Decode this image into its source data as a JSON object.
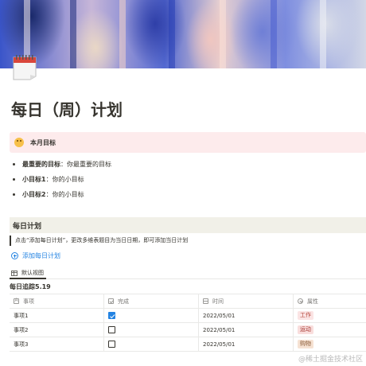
{
  "page": {
    "title": "每日（周）计划",
    "icon": "calendar-icon"
  },
  "callout": {
    "icon": "smile-emoji-icon",
    "text": "本月目标"
  },
  "goals": [
    {
      "label": "最重要的目标",
      "sep": "：",
      "text": "你最重要的目标"
    },
    {
      "label": "小目标1",
      "sep": "：",
      "text": "你的小目标"
    },
    {
      "label": "小目标2",
      "sep": "：",
      "text": "你的小目标"
    }
  ],
  "section": {
    "heading": "每日计划",
    "quote": "点击“添加每日计划”，更改多维表题目为当日日期，即可添加当日计划",
    "add_button": "添加每日计划"
  },
  "database": {
    "view_label": "默认视图",
    "title": "每日追踪5.19",
    "columns": [
      {
        "label": "事项",
        "icon": "text-property-icon"
      },
      {
        "label": "完成",
        "icon": "checkbox-property-icon"
      },
      {
        "label": "时间",
        "icon": "date-property-icon"
      },
      {
        "label": "属性",
        "icon": "select-property-icon"
      }
    ],
    "rows": [
      {
        "name": "事项1",
        "done": true,
        "date": "2022/05/01",
        "tag": "工作",
        "tag_bg": "#fbe4e4",
        "tag_fg": "#b5473b"
      },
      {
        "name": "事项2",
        "done": false,
        "date": "2022/05/01",
        "tag": "运动",
        "tag_bg": "#f9dedd",
        "tag_fg": "#a63a34"
      },
      {
        "name": "事项3",
        "done": false,
        "date": "2022/05/01",
        "tag": "购物",
        "tag_bg": "#f6e2d3",
        "tag_fg": "#8a5a35"
      }
    ]
  },
  "watermark": "@稀土掘金技术社区",
  "colors": {
    "accent": "#2383e2",
    "callout_bg": "#fdebec",
    "section_bg": "#f1f0e8"
  }
}
